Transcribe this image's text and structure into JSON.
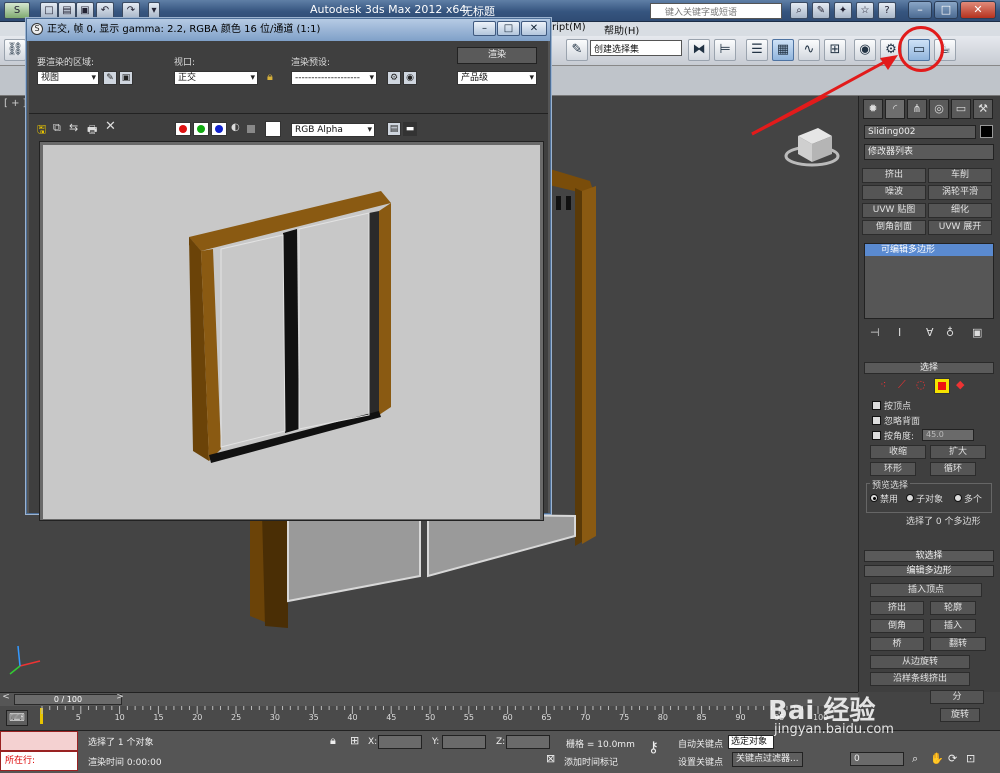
{
  "titlebar": {
    "app_title": "Autodesk 3ds Max  2012 x64",
    "doc_title": "无标题",
    "search_placeholder": "键入关键字或短语"
  },
  "menu": {
    "script_fragment": "ript(M)",
    "help": "帮助(H)"
  },
  "toolbar": {
    "selection_set": "创建选择集"
  },
  "viewport": {
    "label": "[ + ]"
  },
  "render_window": {
    "title": "正交, 帧 0, 显示 gamma: 2.2, RGBA 颜色 16 位/通道 (1:1)",
    "area_label": "要渲染的区域:",
    "area_value": "视图",
    "viewport_label": "视口:",
    "viewport_value": "正交",
    "preset_label": "渲染预设:",
    "preset_value": "--------------------",
    "render_button": "渲染",
    "quality_value": "产品级",
    "channel_value": "RGB Alpha"
  },
  "command_panel": {
    "object_name": "Sliding002",
    "modifier_list": "修改器列表",
    "modifiers": [
      "挤出",
      "车削",
      "噪波",
      "涡轮平滑",
      "UVW 贴图",
      "细化",
      "倒角剖面",
      "UVW 展开"
    ],
    "stack_item": "可编辑多边形",
    "selection": {
      "header": "选择",
      "by_vertex": "按顶点",
      "ignore_backfacing": "忽略背面",
      "by_angle": "按角度:",
      "angle_value": "45.0",
      "shrink": "收缩",
      "grow": "扩大",
      "ring": "环形",
      "loop": "循环",
      "preview_label": "预览选择",
      "preview_off": "禁用",
      "preview_subobj": "子对象",
      "preview_multi": "多个",
      "status": "选择了 0 个多边形"
    },
    "soft_selection": "软选择",
    "edit_poly": {
      "header": "编辑多边形",
      "insert_vertex": "插入顶点",
      "extrude": "挤出",
      "outline": "轮廓",
      "bevel": "倒角",
      "inset": "插入",
      "bridge": "桥",
      "flip": "翻转",
      "hinge": "从边旋转",
      "extrude_spline": "沿样条线挤出",
      "subdivide_fragment": "分",
      "turn": "旋转"
    }
  },
  "timeline": {
    "frame": "0 / 100",
    "ticks": [
      "0",
      "5",
      "10",
      "15",
      "20",
      "25",
      "30",
      "35",
      "40",
      "45",
      "50",
      "55",
      "60",
      "65",
      "70",
      "75",
      "80",
      "85",
      "90",
      "95",
      "100"
    ]
  },
  "status": {
    "maxscript_prompt": "所在行:",
    "selected": "选择了 1 个对象",
    "render_time": "渲染时间  0:00:00",
    "x_label": "X:",
    "y_label": "Y:",
    "z_label": "Z:",
    "grid": "栅格 = 10.0mm",
    "auto_key": "自动关键点",
    "selected_obj": "选定对象",
    "set_key": "设置关键点",
    "key_filters": "关键点过滤器...",
    "add_time_tag": "添加时间标记",
    "frame_value": "0"
  },
  "watermark": {
    "main": "Bai 经验",
    "sub": "jingyan.baidu.com"
  },
  "colors": {
    "highlight": "#e21b1b",
    "frame_wood": "#8a5a12",
    "canvas_bg": "#c8c8c8"
  }
}
